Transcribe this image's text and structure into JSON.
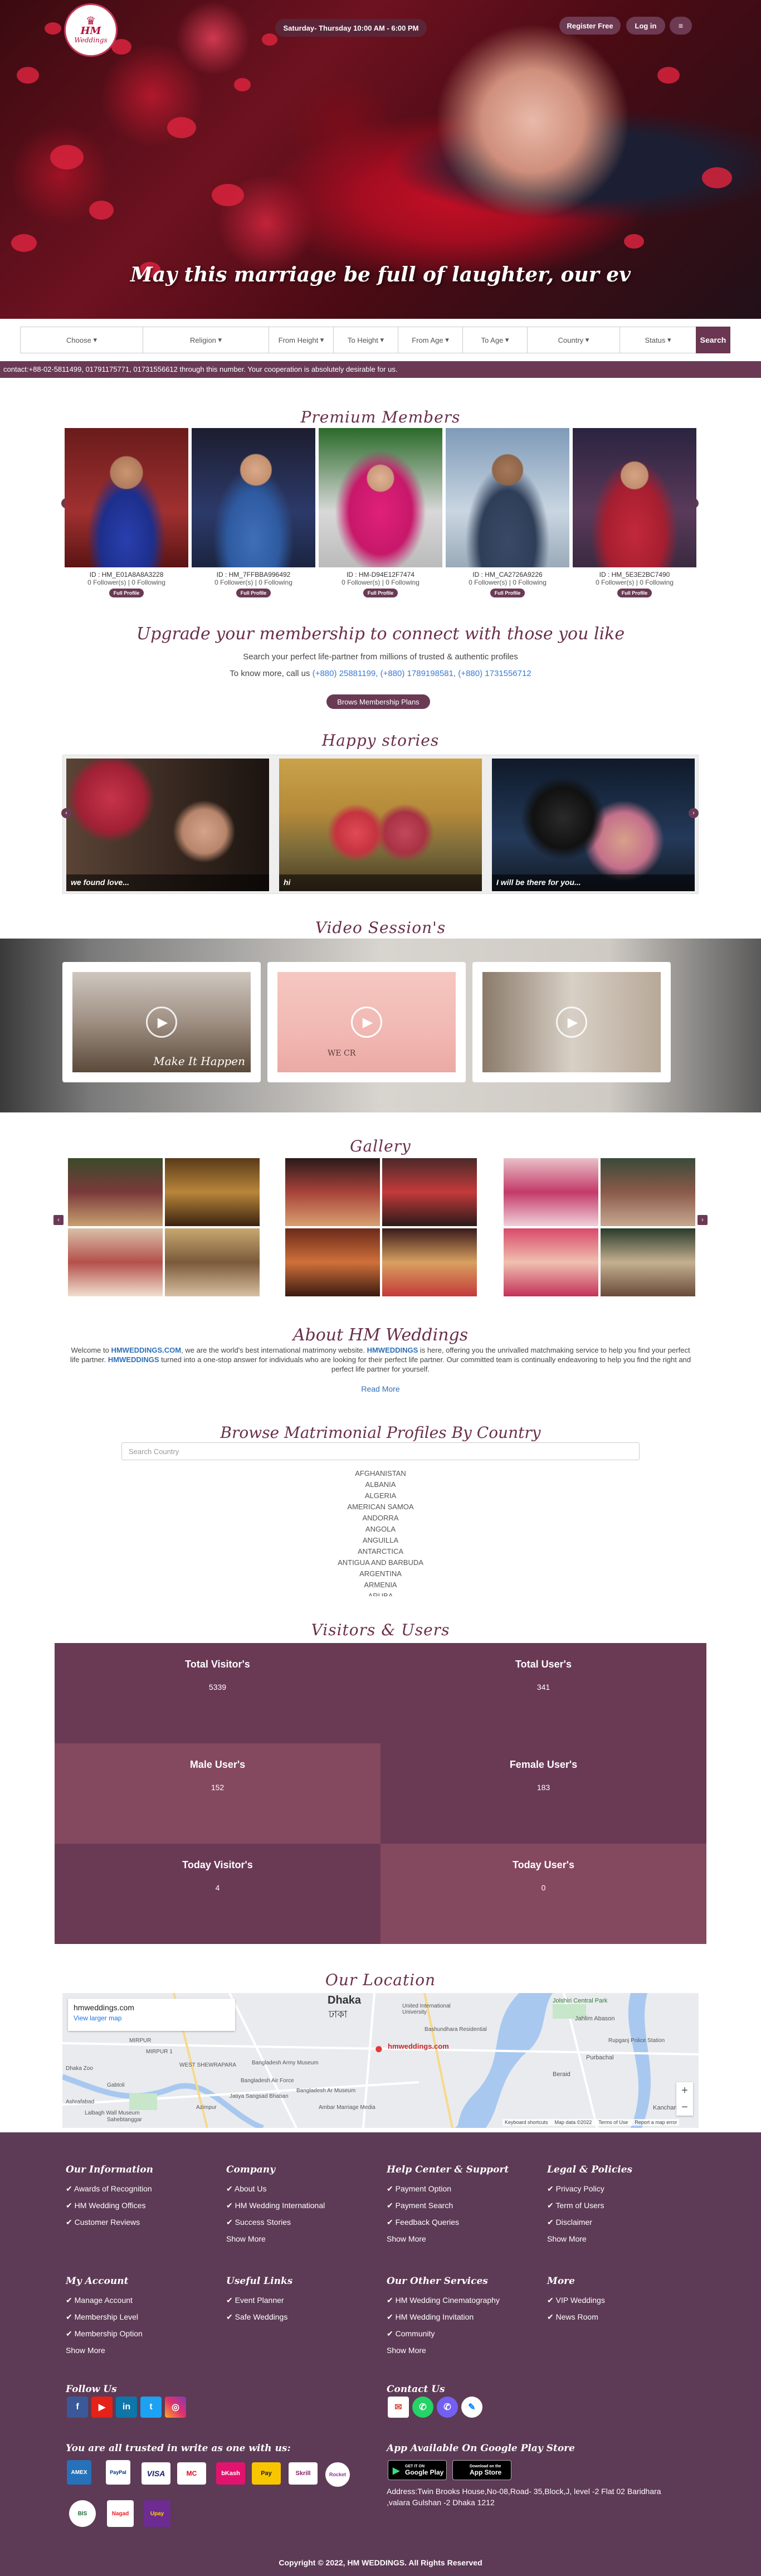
{
  "header": {
    "logo_title": "HM",
    "logo_sub": "Weddings",
    "datetime": "Saturday- Thursday 10:00 AM - 6:00 PM",
    "register_label": "Register Free",
    "login_label": "Log in",
    "menu_icon": "menu-icon"
  },
  "hero": {
    "caption": "May this marriage be full of laughter, our ev"
  },
  "search": {
    "fields": [
      "Choose",
      "Religion",
      "From Height",
      "To Height",
      "From Age",
      "To Age",
      "Country",
      "Status"
    ],
    "button": "Search"
  },
  "contact_strip": "contact:+88-02-5811499, 01791175771, 01731556612 through this number. Your cooperation is absolutely desirable for us.",
  "premium": {
    "title": "Premium Members",
    "members": [
      {
        "id": "ID : HM_E01A8A8A3228",
        "follow": "0 Follower(s) | 0 Following",
        "btn": "Full Profile"
      },
      {
        "id": "ID : HM_7FFBBA996492",
        "follow": "0 Follower(s) | 0 Following",
        "btn": "Full Profile"
      },
      {
        "id": "ID : HM-D94E12F7474",
        "follow": "0 Follower(s) | 0 Following",
        "btn": "Full Profile"
      },
      {
        "id": "ID : HM_CA2726A9226",
        "follow": "0 Follower(s) | 0 Following",
        "btn": "Full Profile"
      },
      {
        "id": "ID : HM_5E3E2BC7490",
        "follow": "0 Follower(s) | 0 Following",
        "btn": "Full Profile"
      }
    ]
  },
  "upgrade": {
    "title": "Upgrade your membership to connect with those you like",
    "subtitle": "Search your perfect life-partner from millions of trusted & authentic profiles",
    "call_prefix": "To know more, call us",
    "phones": "(+880) 25881199, (+880) 1789198581, (+880) 1731556712",
    "button": "Brows Membership Plans"
  },
  "stories": {
    "title": "Happy stories",
    "items": [
      {
        "caption": "we found love..."
      },
      {
        "caption": "hi"
      },
      {
        "caption": "I will be there for you..."
      }
    ]
  },
  "video": {
    "title": "Video Session's",
    "items": [
      {
        "overlay": "Make It Happen"
      },
      {
        "overlay": "WE CR"
      },
      {
        "overlay": ""
      }
    ]
  },
  "gallery": {
    "title": "Gallery"
  },
  "about": {
    "title": "About HM Weddings",
    "text_1": "Welcome to",
    "brand": "HMWEDDINGS.COM",
    "text_2": ", we are the world's best international matrimony website.",
    "brand2": "HMWEDDINGS",
    "text_3": "is here, offering you the unrivalled matchmaking service to help you find your perfect life partner.",
    "brand3": "HMWEDDINGS",
    "text_4": "turned into a one-stop answer for individuals who are looking for their perfect life partner. Our committed team is continually endeavoring to help you find the right and perfect life partner for yourself.",
    "readmore": "Read More"
  },
  "browse": {
    "title": "Browse Matrimonial Profiles By Country",
    "placeholder": "Search Country",
    "countries": [
      "AFGHANISTAN",
      "ALBANIA",
      "ALGERIA",
      "AMERICAN SAMOA",
      "ANDORRA",
      "ANGOLA",
      "ANGUILLA",
      "ANTARCTICA",
      "ANTIGUA AND BARBUDA",
      "ARGENTINA",
      "ARMENIA",
      "ARUBA"
    ]
  },
  "visitors": {
    "title": "Visitors & Users",
    "stats": [
      {
        "label": "Total Visitor's",
        "value": "5339"
      },
      {
        "label": "Total User's",
        "value": "341"
      },
      {
        "label": "Male User's",
        "value": "152"
      },
      {
        "label": "Female User's",
        "value": "183"
      },
      {
        "label": "Today Visitor's",
        "value": "4"
      },
      {
        "label": "Today User's",
        "value": "0"
      }
    ]
  },
  "location": {
    "title": "Our Location",
    "map_card_title": "hmweddings.com",
    "map_card_link": "View larger map",
    "pin_label": "hmweddings.com",
    "city": "Dhaka",
    "city_bn": "ঢাকা",
    "places": [
      "United International University",
      "Jolshiri Central Park",
      "Jahlim Abason",
      "Rupganj Police Station",
      "Bashundhara Residential",
      "MIRPUR 1",
      "WEST SHEWRAPARA",
      "Bangladesh Air Force",
      "Gabtoli",
      "Bangladesh Army Museum",
      "Purbachal",
      "Beraid",
      "Kanchan",
      "Dhaka Zoo",
      "Ashrafabad",
      "Azimpur",
      "Bangladesh Ar Museum",
      "Sahebtanggar",
      "Jatiya Sangsad Bhaban",
      "Lalbagh Wall Museum",
      "MIRPUR",
      "Ambar Marriage Media"
    ],
    "map_footer": [
      "Keyboard shortcuts",
      "Map data ©2022",
      "Terms of Use",
      "Report a map error"
    ]
  },
  "footer": {
    "columns": [
      {
        "title": "Our Information",
        "items": [
          "Awards of Recognition",
          "HM Wedding Offices",
          "Customer Reviews"
        ],
        "more": ""
      },
      {
        "title": "Company",
        "items": [
          "About Us",
          "HM Wedding International",
          "Success Stories"
        ],
        "more": "Show More"
      },
      {
        "title": "Help Center & Support",
        "items": [
          "Payment Option",
          "Payment Search",
          "Feedback Queries"
        ],
        "more": "Show More"
      },
      {
        "title": "Legal & Policies",
        "items": [
          "Privacy Policy",
          "Term of Users",
          "Disclaimer"
        ],
        "more": "Show More"
      },
      {
        "title": "My Account",
        "items": [
          "Manage Account",
          "Membership Level",
          "Membership Option"
        ],
        "more": "Show More"
      },
      {
        "title": "Useful Links",
        "items": [
          "Event Planner",
          "Safe Weddings"
        ],
        "more": ""
      },
      {
        "title": "Our Other Services",
        "items": [
          "HM Wedding Cinematography",
          "HM Wedding Invitation",
          "Community"
        ],
        "more": "Show More"
      },
      {
        "title": "More",
        "items": [
          "VIP Weddings",
          "News Room"
        ],
        "more": ""
      }
    ],
    "follow_title": "Follow Us",
    "contact_title": "Contact Us",
    "trust_title": "You are all trusted in write as one with us:",
    "app_title": "App Available On Google Play Store",
    "google_play_top": "GET IT ON",
    "google_play": "Google Play",
    "app_store_top": "Download on the",
    "app_store": "App Store",
    "address": "Address:Twin Brooks House,No-08,Road- 35,Block,J, level -2 Flat 02 Baridhara ,valara Gulshan -2 Dhaka 1212",
    "payments": [
      "AMEX",
      "PayPal",
      "VISA",
      "MC",
      "bKash",
      "Pay",
      "Skrill",
      "Rocket",
      "BIS",
      "Nagad",
      "Upay",
      "Chaldal"
    ],
    "copyright": "Copyright © 2022, HM WEDDINGS. All Rights Reserved"
  }
}
